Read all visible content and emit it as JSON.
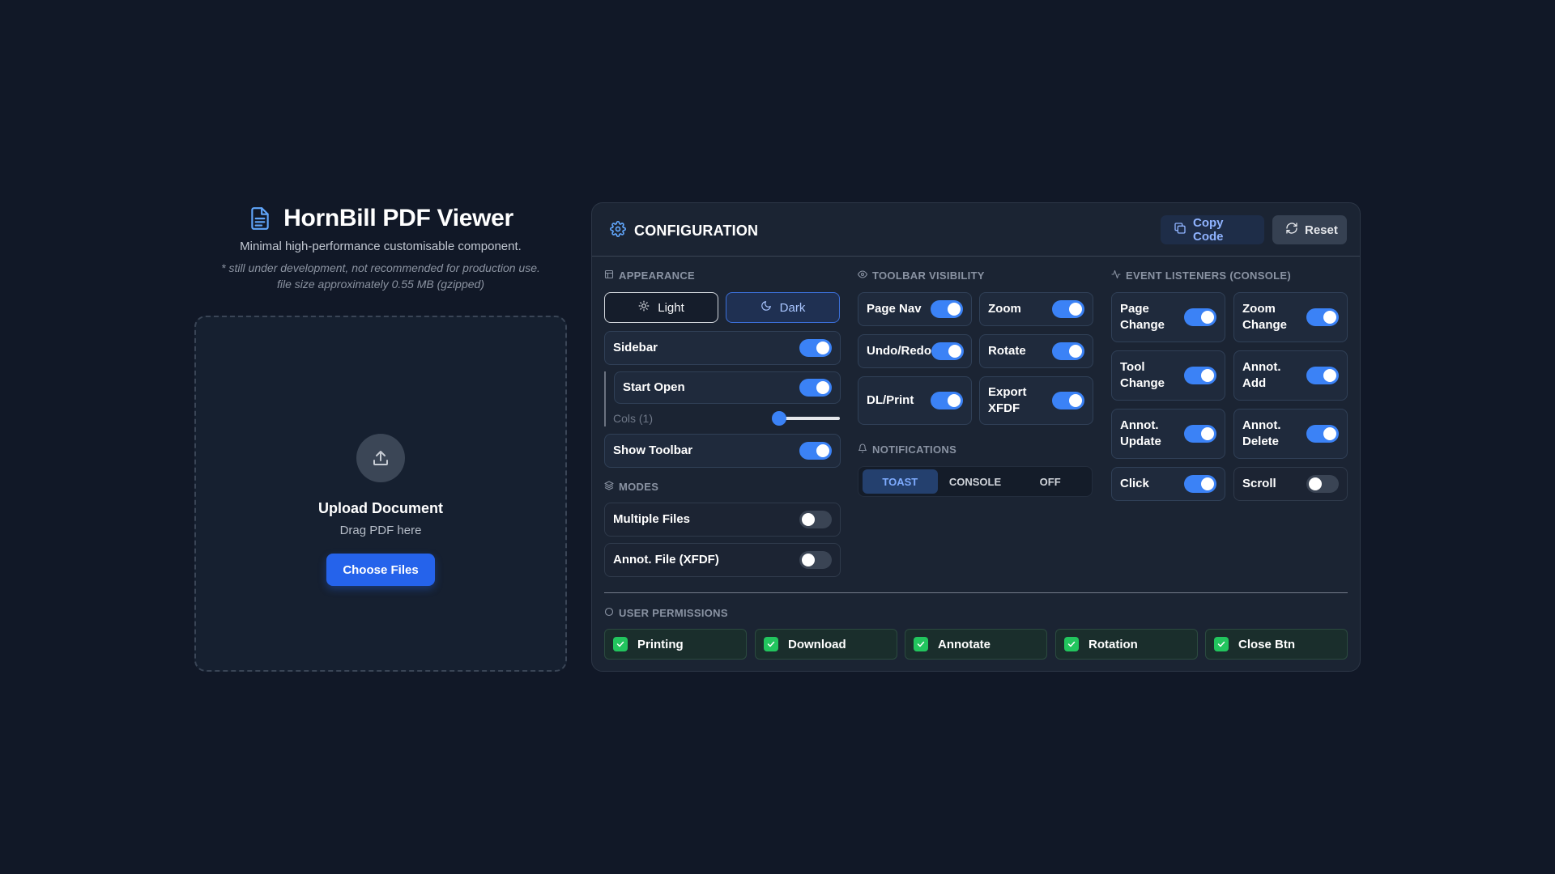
{
  "app": {
    "title": "HornBill PDF Viewer",
    "subtitle": "Minimal high-performance customisable component.",
    "note_line1": "* still under development, not recommended for production use.",
    "note_line2": "file size approximately 0.55 MB (gzipped)",
    "icon": "document-icon"
  },
  "upload": {
    "title": "Upload Document",
    "subtitle": "Drag PDF here",
    "button": "Choose Files",
    "icon": "upload-icon"
  },
  "config": {
    "title": "CONFIGURATION",
    "copy_label": "Copy Code",
    "reset_label": "Reset",
    "appearance": {
      "label": "APPEARANCE",
      "light": "Light",
      "dark": "Dark",
      "selected_theme": "Dark",
      "sidebar": "Sidebar",
      "sidebar_on": true,
      "start_open": "Start Open",
      "start_open_on": true,
      "cols": "Cols (1)",
      "cols_value": 1,
      "show_toolbar": "Show Toolbar",
      "show_toolbar_on": true
    },
    "modes": {
      "label": "MODES",
      "multiple_files": "Multiple Files",
      "multiple_files_on": false,
      "annot_file": "Annot. File (XFDF)",
      "annot_file_on": false
    },
    "toolbar": {
      "label": "TOOLBAR VISIBILITY",
      "page_nav": "Page Nav",
      "zoom": "Zoom",
      "undo_redo": "Undo/Redo",
      "rotate": "Rotate",
      "dl_print": "DL/Print",
      "export_xfdf_1": "Export",
      "export_xfdf_2": "XFDF"
    },
    "notifications": {
      "label": "NOTIFICATIONS",
      "toast": "TOAST",
      "console": "CONSOLE",
      "off": "OFF",
      "selected": "TOAST"
    },
    "events": {
      "label": "EVENT LISTENERS (CONSOLE)",
      "page_change_1": "Page",
      "page_change_2": "Change",
      "zoom_change_1": "Zoom",
      "zoom_change_2": "Change",
      "tool_change_1": "Tool",
      "tool_change_2": "Change",
      "annot_add": "Annot. Add",
      "annot_update_1": "Annot.",
      "annot_update_2": "Update",
      "annot_delete_1": "Annot.",
      "annot_delete_2": "Delete",
      "click": "Click",
      "scroll": "Scroll",
      "scroll_on": false
    },
    "permissions": {
      "label": "USER PERMISSIONS",
      "items": [
        "Printing",
        "Download",
        "Annotate",
        "Rotation",
        "Close Btn"
      ]
    }
  },
  "colors": {
    "background": "#111827",
    "accent": "#3b82f6",
    "primary_button": "#2563eb",
    "check": "#22c55e"
  }
}
